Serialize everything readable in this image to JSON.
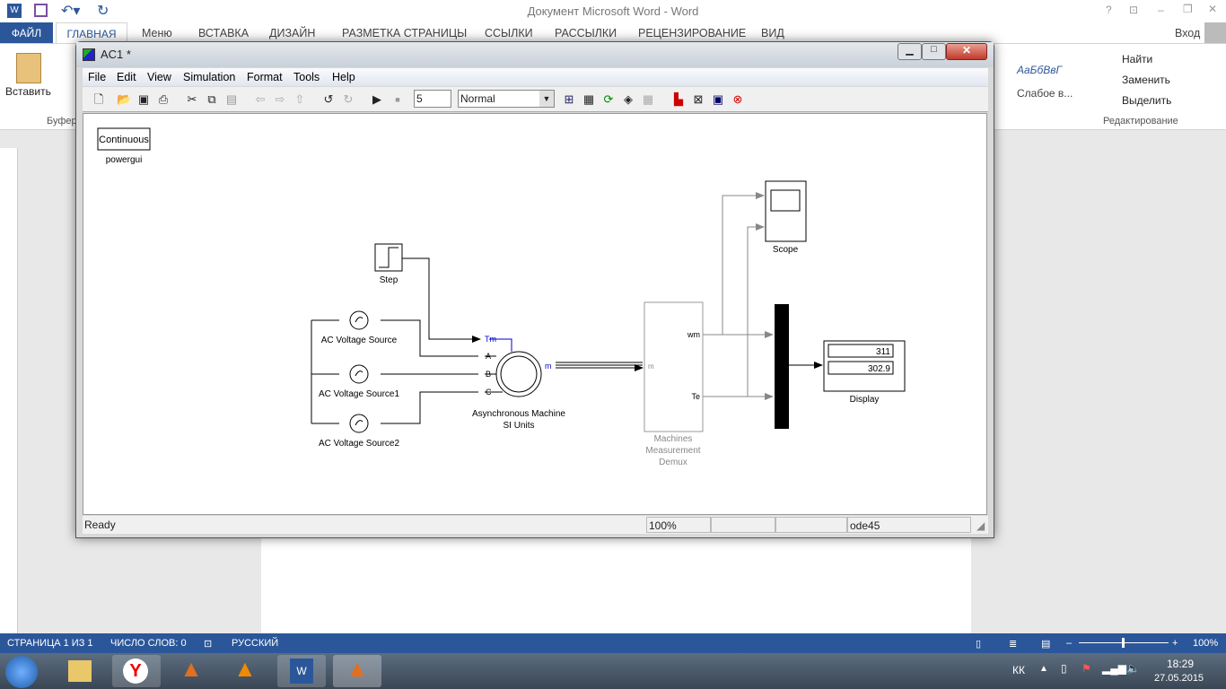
{
  "word": {
    "title": "Документ Microsoft Word - Word",
    "login": "Вход",
    "tabs": [
      "ФАЙЛ",
      "ГЛАВНАЯ",
      "Меню",
      "ВСТАВКА",
      "ДИЗАЙН",
      "РАЗМЕТКА СТРАНИЦЫ",
      "ССЫЛКИ",
      "РАССЫЛКИ",
      "РЕЦЕНЗИРОВАНИЕ",
      "ВИД"
    ],
    "ribbon": {
      "paste": "Вставить",
      "clipboard": "Буфер",
      "styles": [
        "АаБбВвГ",
        "Слабое в..."
      ],
      "find": "Найти",
      "replace": "Заменить",
      "select": "Выделить",
      "editing": "Редактирование"
    },
    "status": {
      "page": "СТРАНИЦА 1 ИЗ 1",
      "words": "ЧИСЛО СЛОВ: 0",
      "lang": "РУССКИЙ",
      "zoom": "100%",
      "zoom_level": 100
    },
    "taskbar": {
      "lang": "КК",
      "time": "18:29",
      "date": "27.05.2015"
    }
  },
  "simulink": {
    "title": "AC1 *",
    "menu": [
      "File",
      "Edit",
      "View",
      "Simulation",
      "Format",
      "Tools",
      "Help"
    ],
    "stop_time": "5",
    "mode": "Normal",
    "status": {
      "state": "Ready",
      "zoom": "100%",
      "solver": "ode45"
    },
    "blocks": {
      "powergui_text": "Continuous",
      "powergui": "powergui",
      "step": "Step",
      "ac1": "AC Voltage Source",
      "ac2": "AC Voltage Source1",
      "ac3": "AC Voltage Source2",
      "machine": [
        "Asynchronous Machine",
        "SI Units"
      ],
      "machine_ports": [
        "Tm",
        "A",
        "B",
        "C",
        "m"
      ],
      "demux": [
        "Machines",
        "Measurement",
        "Demux"
      ],
      "demux_ports": [
        "m",
        "wm",
        "Te"
      ],
      "scope": "Scope",
      "display": "Display",
      "display_values": [
        "311",
        "302.9"
      ]
    }
  }
}
